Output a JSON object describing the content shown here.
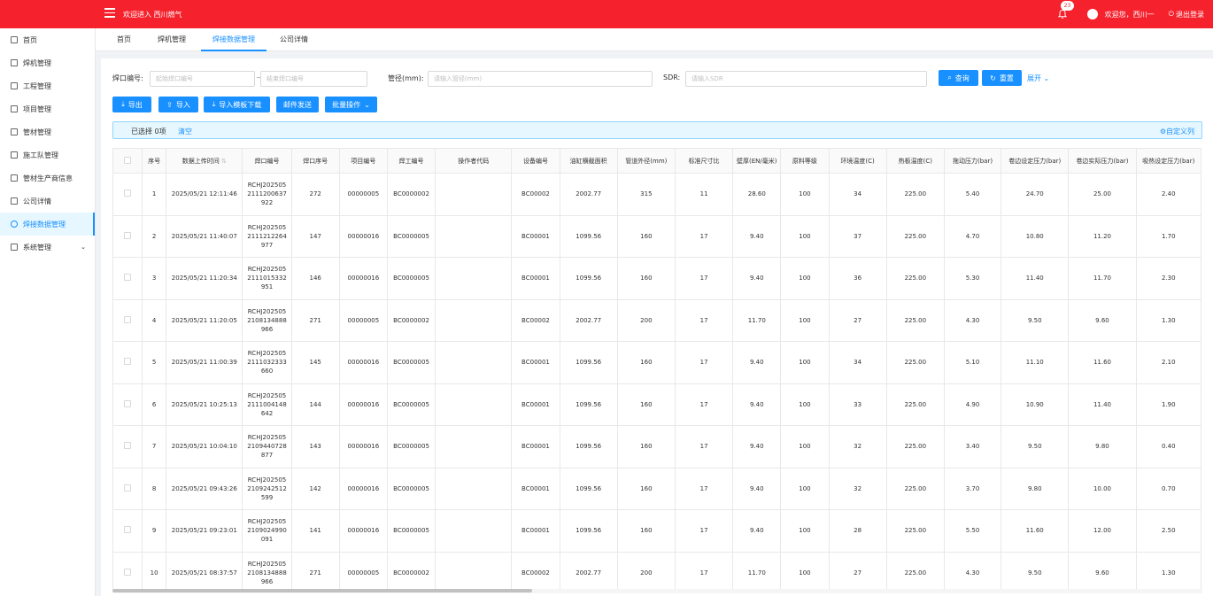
{
  "header": {
    "welcome": "欢迎进入 西川燃气",
    "badge_count": "23",
    "user_greeting": "欢迎您，西川一",
    "logout": "退出登录",
    "brand_color": "#f5222d"
  },
  "sidebar": {
    "items": [
      {
        "label": "首页",
        "icon": "home-icon"
      },
      {
        "label": "焊机管理",
        "icon": "welder-icon"
      },
      {
        "label": "工程管理",
        "icon": "project-icon"
      },
      {
        "label": "项目管理",
        "icon": "item-icon"
      },
      {
        "label": "管材管理",
        "icon": "pipe-icon"
      },
      {
        "label": "施工队管理",
        "icon": "team-icon"
      },
      {
        "label": "管材生产商信息",
        "icon": "shield-icon"
      },
      {
        "label": "公司详情",
        "icon": "company-icon"
      },
      {
        "label": "焊接数据管理",
        "icon": "chart-pie-icon"
      },
      {
        "label": "系统管理",
        "icon": "gear-icon"
      }
    ],
    "active_index": 8
  },
  "tabs": [
    "首页",
    "焊机管理",
    "焊接数据管理",
    "公司详情"
  ],
  "active_tab": 2,
  "filters": {
    "weld_no_label": "焊口编号:",
    "start_placeholder": "起始焊口编号",
    "end_placeholder": "结束焊口编号",
    "range_sep": "~",
    "diameter_label": "管径(mm):",
    "diameter_placeholder": "请输入管径(mm)",
    "sdr_label": "SDR:",
    "sdr_placeholder": "请输入SDR",
    "query": "查询",
    "reset": "重置",
    "expand": "展开"
  },
  "toolbar": {
    "export": "导出",
    "import": "导入",
    "template_download": "导入模板下载",
    "email_send": "邮件发送",
    "batch": "批量操作"
  },
  "selection": {
    "text": "已选择 0项",
    "clear": "清空",
    "custom_columns": "自定义列"
  },
  "table": {
    "columns": [
      "序号",
      "数据上传时间",
      "焊口编号",
      "焊口序号",
      "项目编号",
      "焊工编号",
      "操作者代码",
      "设备编号",
      "油缸横截面积",
      "管道外径(mm)",
      "标准尺寸比",
      "壁厚(EN/毫米)",
      "原料等级",
      "环境温度(C)",
      "热板温度(C)",
      "拖动压力(bar)",
      "卷边设定压力(bar)",
      "卷边实际压力(bar)",
      "吸热设定压力(bar)"
    ],
    "rows": [
      [
        "1",
        "2025/05/21 12:11:46",
        "RCHJ2025052111200637922",
        "272",
        "00000005",
        "BC0000002",
        "",
        "BC00002",
        "2002.77",
        "315",
        "11",
        "28.60",
        "100",
        "34",
        "225.00",
        "5.40",
        "24.70",
        "25.00",
        "2.40"
      ],
      [
        "2",
        "2025/05/21 11:40:07",
        "RCHJ2025052111212264977",
        "147",
        "00000016",
        "BC0000005",
        "",
        "BC00001",
        "1099.56",
        "160",
        "17",
        "9.40",
        "100",
        "37",
        "225.00",
        "4.70",
        "10.80",
        "11.20",
        "1.70"
      ],
      [
        "3",
        "2025/05/21 11:20:34",
        "RCHJ2025052111015332951",
        "146",
        "00000016",
        "BC0000005",
        "",
        "BC00001",
        "1099.56",
        "160",
        "17",
        "9.40",
        "100",
        "36",
        "225.00",
        "5.30",
        "11.40",
        "11.70",
        "2.30"
      ],
      [
        "4",
        "2025/05/21 11:20:05",
        "RCHJ2025052108134888966",
        "271",
        "00000005",
        "BC0000002",
        "",
        "BC00002",
        "2002.77",
        "200",
        "17",
        "11.70",
        "100",
        "27",
        "225.00",
        "4.30",
        "9.50",
        "9.60",
        "1.30"
      ],
      [
        "5",
        "2025/05/21 11:00:39",
        "RCHJ2025052111032333660",
        "145",
        "00000016",
        "BC0000005",
        "",
        "BC00001",
        "1099.56",
        "160",
        "17",
        "9.40",
        "100",
        "34",
        "225.00",
        "5.10",
        "11.10",
        "11.60",
        "2.10"
      ],
      [
        "6",
        "2025/05/21 10:25:13",
        "RCHJ2025052111004148642",
        "144",
        "00000016",
        "BC0000005",
        "",
        "BC00001",
        "1099.56",
        "160",
        "17",
        "9.40",
        "100",
        "33",
        "225.00",
        "4.90",
        "10.90",
        "11.40",
        "1.90"
      ],
      [
        "7",
        "2025/05/21 10:04:10",
        "RCHJ2025052109440728877",
        "143",
        "00000016",
        "BC0000005",
        "",
        "BC00001",
        "1099.56",
        "160",
        "17",
        "9.40",
        "100",
        "32",
        "225.00",
        "3.40",
        "9.50",
        "9.80",
        "0.40"
      ],
      [
        "8",
        "2025/05/21 09:43:26",
        "RCHJ2025052109242512599",
        "142",
        "00000016",
        "BC0000005",
        "",
        "BC00001",
        "1099.56",
        "160",
        "17",
        "9.40",
        "100",
        "32",
        "225.00",
        "3.70",
        "9.80",
        "10.00",
        "0.70"
      ],
      [
        "9",
        "2025/05/21 09:23:01",
        "RCHJ2025052109024990091",
        "141",
        "00000016",
        "BC0000005",
        "",
        "BC00001",
        "1099.56",
        "160",
        "17",
        "9.40",
        "100",
        "28",
        "225.00",
        "5.50",
        "11.60",
        "12.00",
        "2.50"
      ],
      [
        "10",
        "2025/05/21 08:37:57",
        "RCHJ2025052108134888966",
        "271",
        "00000005",
        "BC0000002",
        "",
        "BC00002",
        "2002.77",
        "200",
        "17",
        "11.70",
        "100",
        "27",
        "225.00",
        "4.30",
        "9.50",
        "9.60",
        "1.30"
      ]
    ]
  }
}
